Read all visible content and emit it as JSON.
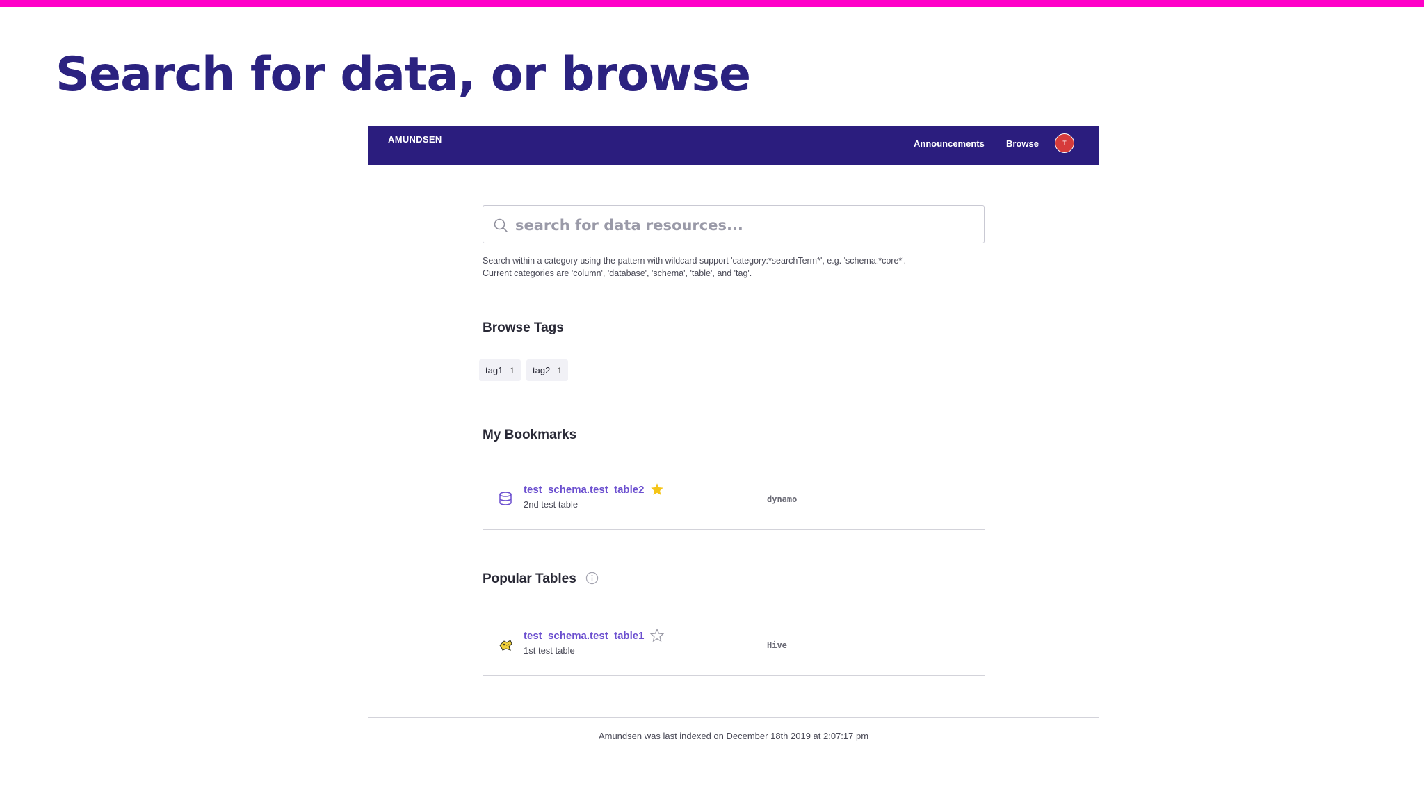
{
  "slide": {
    "title": "Search for data, or browse",
    "accent_color": "#ff00c8",
    "title_color": "#2b2280"
  },
  "navbar": {
    "brand": "AMUNDSEN",
    "links": [
      "Announcements",
      "Browse"
    ],
    "avatar_initial": "T",
    "background": "#2b1d7e",
    "avatar_color": "#d63b3b"
  },
  "search": {
    "placeholder": "search for data resources...",
    "hint_line1": "Search within a category using the pattern with wildcard support 'category:*searchTerm*', e.g. 'schema:*core*'.",
    "hint_line2": "Current categories are 'column', 'database', 'schema', 'table', and 'tag'."
  },
  "browse_tags": {
    "title": "Browse Tags",
    "tags": [
      {
        "name": "tag1",
        "count": "1"
      },
      {
        "name": "tag2",
        "count": "1"
      }
    ]
  },
  "bookmarks": {
    "title": "My Bookmarks",
    "items": [
      {
        "name": "test_schema.test_table2",
        "description": "2nd test table",
        "source": "dynamo",
        "bookmarked": true,
        "icon": "database-icon"
      }
    ]
  },
  "popular": {
    "title": "Popular Tables",
    "items": [
      {
        "name": "test_schema.test_table1",
        "description": "1st test table",
        "source": "Hive",
        "bookmarked": false,
        "icon": "hive-icon"
      }
    ]
  },
  "footer": {
    "text": "Amundsen was last indexed on December 18th 2019 at 2:07:17 pm"
  },
  "colors": {
    "link": "#6b4fcf",
    "star_filled": "#f5c518"
  }
}
